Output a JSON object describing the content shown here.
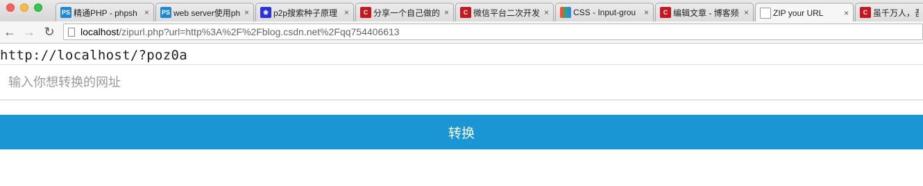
{
  "browser": {
    "tabs": [
      {
        "title": "精通PHP - phpsh",
        "favicon": "ps-icon",
        "favicon_text": "PS"
      },
      {
        "title": "web server使用ph",
        "favicon": "ps-icon",
        "favicon_text": "PS"
      },
      {
        "title": "p2p搜索种子原理",
        "favicon": "baidu-paw-icon",
        "favicon_text": "❀"
      },
      {
        "title": "分享一个自己做的",
        "favicon": "csdn-c-icon",
        "favicon_text": "C"
      },
      {
        "title": "微信平台二次开发",
        "favicon": "csdn-c-icon",
        "favicon_text": "C"
      },
      {
        "title": "CSS - Input-grou",
        "favicon": "css-grid-icon",
        "favicon_text": ""
      },
      {
        "title": "编辑文章 - 博客频",
        "favicon": "csdn-c-icon",
        "favicon_text": "C"
      },
      {
        "title": "ZIP your URL",
        "favicon": "page-icon",
        "favicon_text": "",
        "active": true
      },
      {
        "title": "虽千万人，吾往",
        "favicon": "csdn-c-icon",
        "favicon_text": "C"
      }
    ],
    "tab_close_glyph": "×",
    "nav": {
      "back": "←",
      "forward": "→",
      "reload": "↻"
    },
    "address": {
      "host": "localhost",
      "path": "/zipurl.php?url=http%3A%2F%2Fblog.csdn.net%2Fqq754406613"
    }
  },
  "page": {
    "short_url": "http://localhost/?poz0a",
    "input_value": "",
    "input_placeholder": "输入你想转换的网址",
    "button_label": "转换"
  },
  "colors": {
    "button_bg": "#1a96d4",
    "button_text": "#ffffff"
  }
}
